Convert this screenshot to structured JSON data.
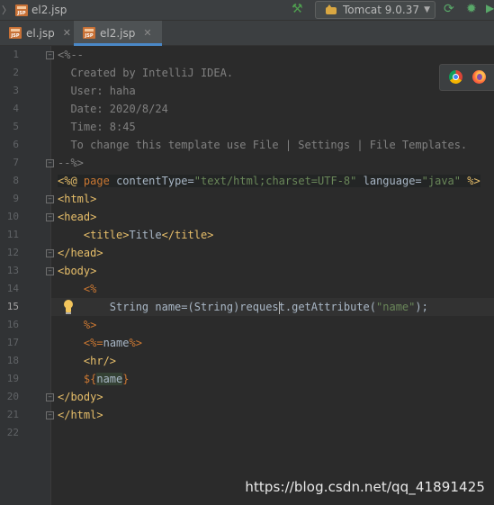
{
  "toolbar": {
    "breadcrumb_file": "el2.jsp",
    "run_config": "Tomcat 9.0.37"
  },
  "tabs": [
    {
      "label": "el.jsp",
      "active": false
    },
    {
      "label": "el2.jsp",
      "active": true
    }
  ],
  "editor": {
    "line_numbers": [
      "1",
      "2",
      "3",
      "4",
      "5",
      "6",
      "7",
      "8",
      "9",
      "10",
      "11",
      "12",
      "13",
      "14",
      "15",
      "16",
      "17",
      "18",
      "19",
      "20",
      "21",
      "22"
    ],
    "current_line": "15",
    "lines": {
      "l1": "<%--",
      "l2": "  Created by IntelliJ IDEA.",
      "l3": "  User: haha",
      "l4": "  Date: 2020/8/24",
      "l5": "  Time: 8:45",
      "l6": "  To change this template use File | Settings | File Templates.",
      "l7": "--%>",
      "l8": {
        "open": "<%@",
        "page": "page",
        "attr1": "contentType=",
        "val1": "\"text/html;charset=UTF-8\"",
        "attr2": "language=",
        "val2": "\"java\"",
        "close": "%>"
      },
      "l9": "<html>",
      "l10": "<head>",
      "l11": {
        "open": "<title>",
        "text": "Title",
        "close": "</title>"
      },
      "l12": "</head>",
      "l13": "<body>",
      "l14": "<%",
      "l15": {
        "before_caret": "String name=(String)reques",
        "after_caret": "t.getAttribute(",
        "str": "\"name\"",
        "end": ");"
      },
      "l16": "%>",
      "l17": {
        "open": "<%=",
        "text": "name",
        "close": "%>"
      },
      "l18": "<hr/>",
      "l19": {
        "open": "${",
        "var": "name",
        "close": "}"
      },
      "l20": "</body>",
      "l21": "</html>"
    }
  },
  "watermark": "https://blog.csdn.net/qq_41891425",
  "colors": {
    "editor_bg": "#2b2b2b",
    "comment": "#808080",
    "tag": "#e8bf6a",
    "keyword": "#cc7832",
    "string": "#6a8759",
    "text": "#a9b7c6",
    "tab_underline": "#4a88c7"
  },
  "icons": [
    "jsp-file-icon",
    "hammer-icon",
    "tomcat-icon",
    "rerun-icon",
    "debug-icon",
    "chrome-icon",
    "firefox-icon",
    "lightbulb-icon"
  ]
}
